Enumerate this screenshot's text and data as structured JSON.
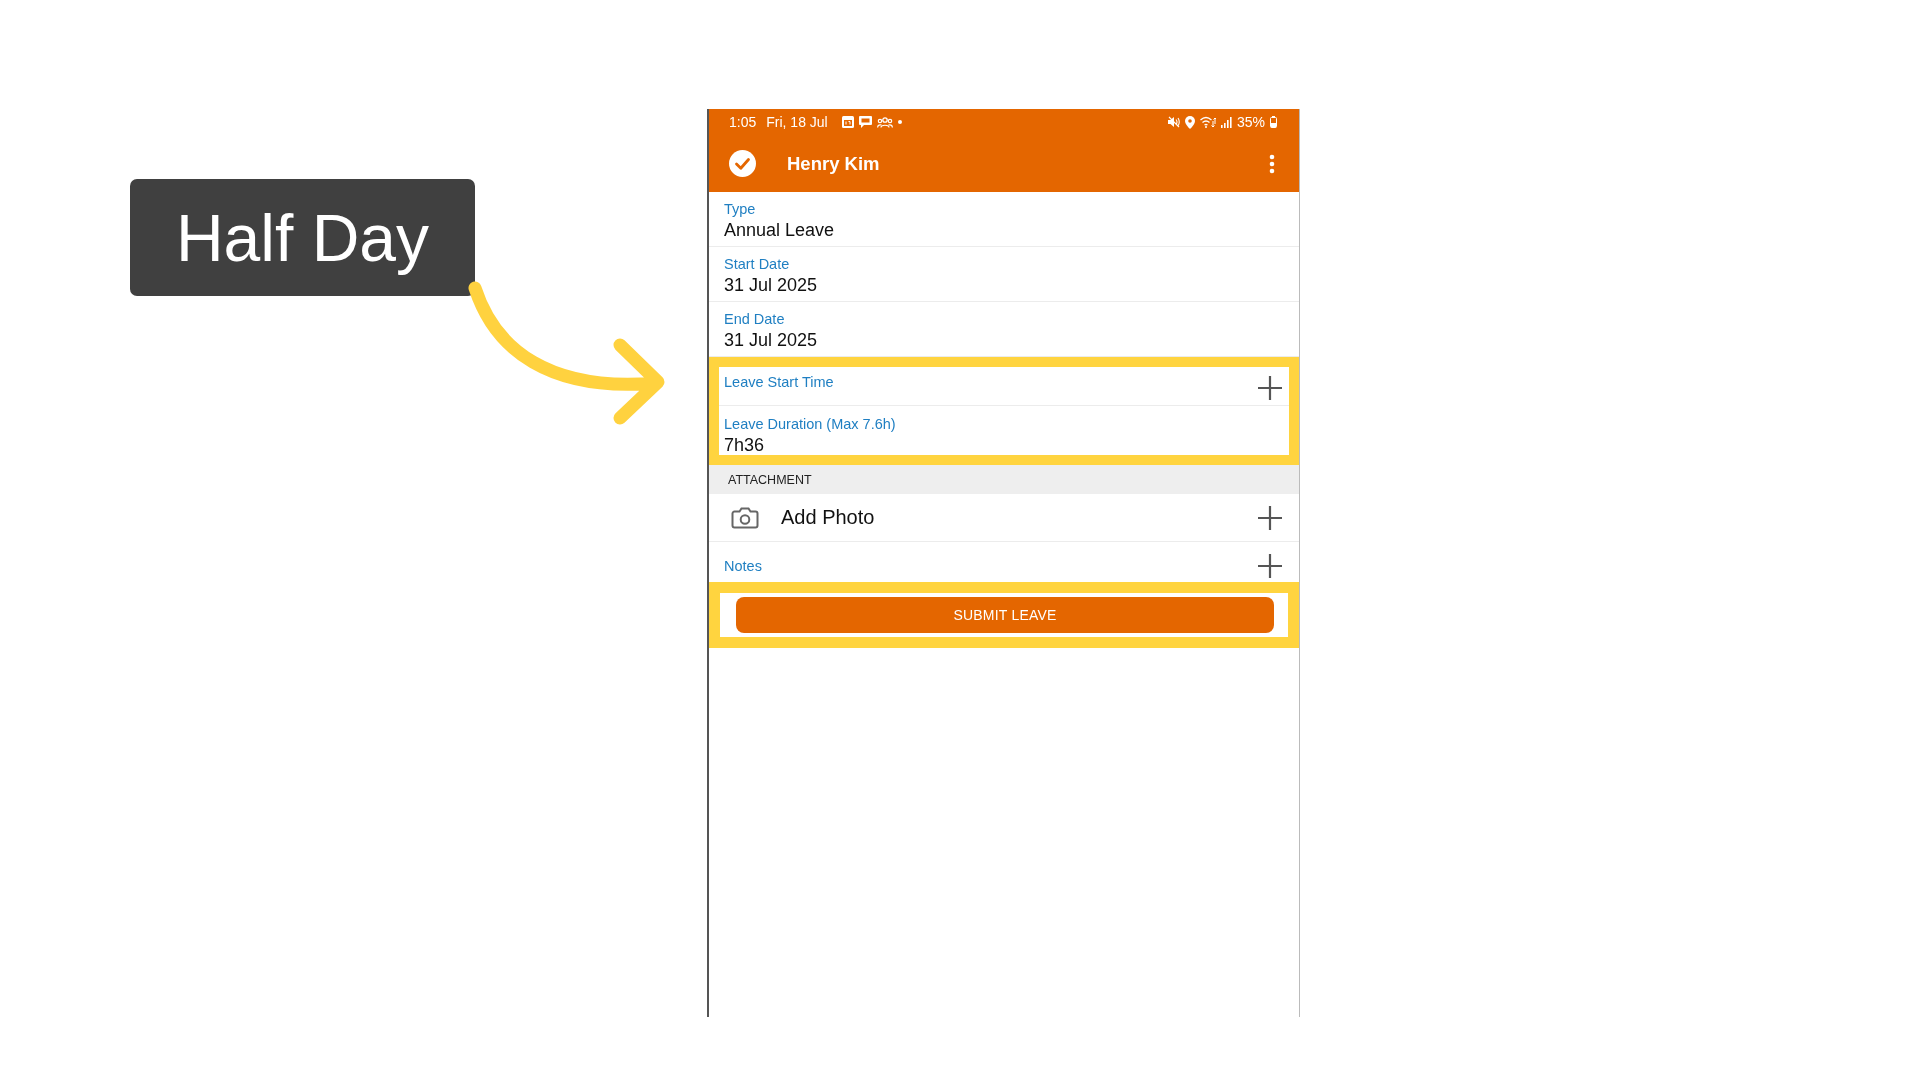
{
  "callout": {
    "label": "Half Day"
  },
  "phone": {
    "status_bar": {
      "time": "1:05",
      "date": "Fri, 18 Jul",
      "battery": "35%"
    },
    "app_bar": {
      "title": "Henry Kim"
    },
    "field_groups": [
      {
        "highlighted": false,
        "fields": [
          {
            "kind": "value",
            "label": "Type",
            "value": "Annual Leave"
          },
          {
            "kind": "value",
            "label": "Start Date",
            "value": "31 Jul 2025"
          },
          {
            "kind": "value",
            "label": "End Date",
            "value": "31 Jul 2025"
          }
        ]
      },
      {
        "highlighted": true,
        "fields": [
          {
            "kind": "add",
            "label": "Leave Start Time"
          },
          {
            "kind": "value",
            "label": "Leave Duration (Max 7.6h)",
            "value": "7h36"
          }
        ]
      }
    ],
    "attachment": {
      "heading": "ATTACHMENT",
      "rows": [
        {
          "kind": "photo",
          "label": "Add Photo"
        },
        {
          "kind": "note",
          "label": "Notes"
        }
      ]
    },
    "submit": {
      "label": "SUBMIT LEAVE",
      "highlighted": true
    }
  }
}
